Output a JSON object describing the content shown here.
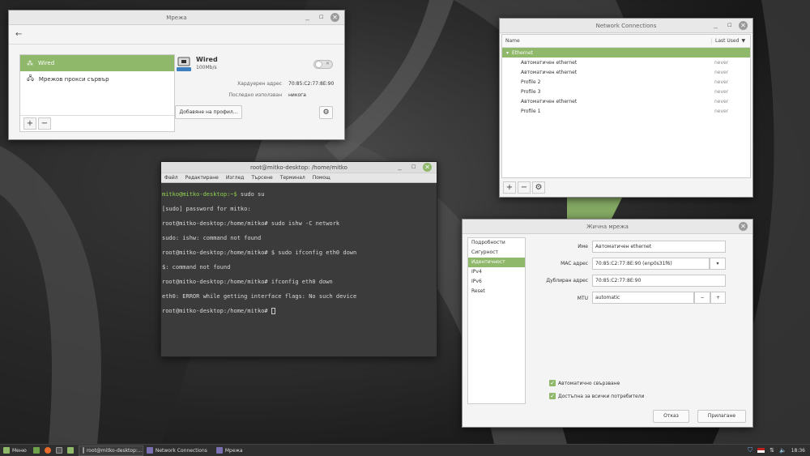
{
  "net_window": {
    "title": "Мрежа",
    "back_icon": "←",
    "sidebar": [
      {
        "label": "Wired",
        "icon": "wired-icon",
        "active": true
      },
      {
        "label": "Мрежов прокси сървър",
        "icon": "proxy-icon",
        "active": false
      }
    ],
    "add_label": "+",
    "remove_label": "−",
    "device_name": "Wired",
    "device_speed": "100Mb/s",
    "hw_label": "Хардуерен адрес",
    "hw_value": "70:85:C2:77:8E:90",
    "last_used_label": "Последно използван",
    "last_used_value": "никога",
    "add_profile_button": "Добавяне на профил...",
    "settings_icon": "⚙"
  },
  "terminal": {
    "title": "root@mitko-desktop: /home/mitko",
    "menus": [
      "Файл",
      "Редактиране",
      "Изглед",
      "Търсене",
      "Терминал",
      "Помощ"
    ],
    "lines": [
      {
        "prompt": "mitko@mitko-desktop:~$",
        "text": " sudo su"
      },
      {
        "prompt": "",
        "text": "[sudo] password for mitko:"
      },
      {
        "prompt": "",
        "text": "root@mitko-desktop:/home/mitko# sudo ishw -C network"
      },
      {
        "prompt": "",
        "text": "sudo: ishw: command not found"
      },
      {
        "prompt": "",
        "text": "root@mitko-desktop:/home/mitko# $ sudo ifconfig eth0 down"
      },
      {
        "prompt": "",
        "text": "$: command not found"
      },
      {
        "prompt": "",
        "text": "root@mitko-desktop:/home/mitko# ifconfig eth0 down"
      },
      {
        "prompt": "",
        "text": "eth0: ERROR while getting interface flags: No such device"
      },
      {
        "prompt": "",
        "text": "root@mitko-desktop:/home/mitko# "
      }
    ]
  },
  "netconn": {
    "title": "Network Connections",
    "col_name": "Name",
    "col_last_used": "Last Used",
    "group": "Ethernet",
    "rows": [
      {
        "name": "Автоматичен ethernet",
        "last": "never"
      },
      {
        "name": "Автоматичен ethernet",
        "last": "never"
      },
      {
        "name": "Profile 2",
        "last": "never"
      },
      {
        "name": "Profile 3",
        "last": "never"
      },
      {
        "name": "Автоматичен ethernet",
        "last": "never"
      },
      {
        "name": "Profile 1",
        "last": "never"
      }
    ],
    "add": "+",
    "remove": "−",
    "settings": "⚙"
  },
  "edit": {
    "title": "Жична мрежа",
    "tabs": [
      "Подробности",
      "Сигурност",
      "Идентичност",
      "IPv4",
      "IPv6",
      "Reset"
    ],
    "active_tab": 2,
    "name_label": "Име",
    "name_value": "Автоматичен ethernet",
    "mac_label": "MAC адрес",
    "mac_value": "70:85:C2:77:8E:90 (enp0s31f6)",
    "cloned_label": "Дублиран адрес",
    "cloned_value": "70:85:C2:77:8E:90",
    "mtu_label": "MTU",
    "mtu_value": "automatic",
    "mtu_minus": "−",
    "mtu_plus": "+",
    "auto_connect": "Автоматично свързване",
    "all_users": "Достъпна за всички потребители",
    "cancel": "Отказ",
    "apply": "Прилагане"
  },
  "taskbar": {
    "menu": "Меню",
    "tasks": [
      "root@mitko-desktop:...",
      "Network Connections",
      "Мрежа"
    ],
    "time": "18:36"
  },
  "colors": {
    "accent": "#8fb86a"
  }
}
